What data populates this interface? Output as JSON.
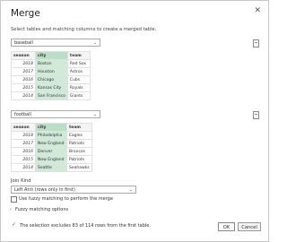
{
  "dialog": {
    "title": "Merge",
    "subtitle": "Select tables and matching columns to create a merged table.",
    "close_glyph": "✕"
  },
  "table1": {
    "selected": "baseball",
    "headers": [
      "season",
      "city",
      "team"
    ],
    "rows": [
      [
        "2018",
        "Boston",
        "Red Sox"
      ],
      [
        "2017",
        "Houston",
        "Astros"
      ],
      [
        "2016",
        "Chicago",
        "Cubs"
      ],
      [
        "2015",
        "Kansas City",
        "Royals"
      ],
      [
        "2014",
        "San Francisco",
        "Giants"
      ]
    ]
  },
  "table2": {
    "selected": "football",
    "headers": [
      "season",
      "city",
      "team"
    ],
    "rows": [
      [
        "2018",
        "Philadelphia",
        "Eagles"
      ],
      [
        "2017",
        "New England",
        "Patriots"
      ],
      [
        "2016",
        "Denver",
        "Broncos"
      ],
      [
        "2015",
        "New England",
        "Patriots"
      ],
      [
        "2014",
        "Seattle",
        "Seahawks"
      ]
    ]
  },
  "join": {
    "label": "Join Kind",
    "selected": "Left Anti (rows only in first)",
    "fuzzy_checkbox_label": "Use fuzzy matching to perform the merge",
    "fuzzy_checked": false
  },
  "fuzzy_options": {
    "label": "Fuzzy matching options"
  },
  "status": "The selection excludes 83 of 114 rows from the first table.",
  "buttons": {
    "ok": "OK",
    "cancel": "Cancel"
  }
}
